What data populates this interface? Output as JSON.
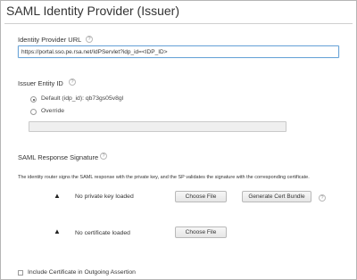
{
  "page": {
    "title": "SAML Identity Provider (Issuer)"
  },
  "idp_url": {
    "label": "Identity Provider URL",
    "value": "https://portal.sso.pe.rsa.net/IdPServlet?idp_id=<IDP_ID>"
  },
  "issuer_entity": {
    "label": "Issuer Entity ID",
    "default_option": "Default (idp_id): qb73gs05v8gl",
    "override_option": "Override",
    "override_value": "",
    "selected": "default"
  },
  "saml_response": {
    "label": "SAML Response Signature",
    "description": "The identity router signs the SAML response with the private key, and the SP validates the signature with the corresponding certificate.",
    "private_key": {
      "status": "No private key loaded",
      "choose_file": "Choose File",
      "generate": "Generate Cert Bundle"
    },
    "certificate": {
      "status": "No certificate loaded",
      "choose_file": "Choose File"
    }
  },
  "include_certificate": {
    "label": "Include Certificate in Outgoing Assertion",
    "checked": false
  },
  "icons": {
    "help": "?",
    "warning": "▲"
  }
}
